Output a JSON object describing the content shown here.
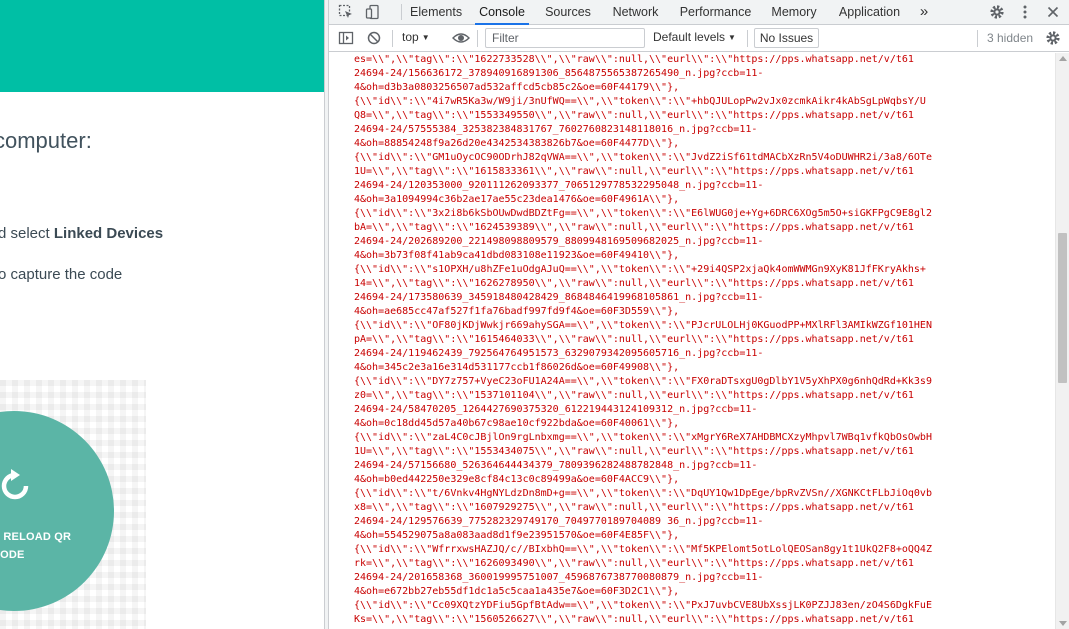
{
  "page": {
    "instruction_title": "computer:",
    "step1_prefix": "d select ",
    "step1_bold": "Linked Devices",
    "step2": "o capture the code",
    "reload_line1": "D RELOAD QR",
    "reload_line2": "CODE",
    "accent": "#00bfa5"
  },
  "devtools": {
    "tabs": [
      {
        "label": "Elements",
        "active": false
      },
      {
        "label": "Console",
        "active": true
      },
      {
        "label": "Sources",
        "active": false
      },
      {
        "label": "Network",
        "active": false
      },
      {
        "label": "Performance",
        "active": false
      },
      {
        "label": "Memory",
        "active": false
      },
      {
        "label": "Application",
        "active": false
      }
    ],
    "more_tabs": "»",
    "context": "top",
    "filter_placeholder": "Filter",
    "levels": "Default levels",
    "issues": "No Issues",
    "hidden": "3 hidden",
    "log_color": "#c80000",
    "log_lines": [
      "es=\\\\\",\\\\\"tag\\\\\":\\\\\"1622733528\\\\\",\\\\\"raw\\\\\":null,\\\\\"eurl\\\\\":\\\\\"https://pps.whatsapp.net/v/t61",
      "24694-24/156636172_378940916891306_8564875565387265490_n.jpg?ccb=11-",
      "4&oh=d3b3a0803256507ad532affcd5cb85c2&oe=60F44179\\\\\"},",
      "{\\\\\"id\\\\\":\\\\\"4i7wR5Ka3w/W9ji/3nUfWQ==\\\\\",\\\\\"token\\\\\":\\\\\"+hbQJULopPw2vJx0zcmkAikr4kAbSgLpWqbsY/U",
      "Q8=\\\\\",\\\\\"tag\\\\\":\\\\\"1553349550\\\\\",\\\\\"raw\\\\\":null,\\\\\"eurl\\\\\":\\\\\"https://pps.whatsapp.net/v/t61",
      "24694-24/57555384_325382384831767_7602760823148118016_n.jpg?ccb=11-",
      "4&oh=88854248f9a26d20e4342534383826b7&oe=60F4477D\\\\\"},",
      "{\\\\\"id\\\\\":\\\\\"GM1uOycOC90ODrhJ82qVWA==\\\\\",\\\\\"token\\\\\":\\\\\"JvdZ2iSf61tdMACbXzRn5V4oDUWHR2i/3a8/6OTe",
      "1U=\\\\\",\\\\\"tag\\\\\":\\\\\"1615833361\\\\\",\\\\\"raw\\\\\":null,\\\\\"eurl\\\\\":\\\\\"https://pps.whatsapp.net/v/t61",
      "24694-24/120353000_920111262093377_7065129778532295048_n.jpg?ccb=11-",
      "4&oh=3a1094994c36b2ae17ae55c23dea1476&oe=60F4961A\\\\\"},",
      "{\\\\\"id\\\\\":\\\\\"3x2i8b6kSbOUwDwdBDZtFg==\\\\\",\\\\\"token\\\\\":\\\\\"E6lWUG0je+Yg+6DRC6XOg5m5O+siGKFPgC9E8gl2",
      "bA=\\\\\",\\\\\"tag\\\\\":\\\\\"1624539389\\\\\",\\\\\"raw\\\\\":null,\\\\\"eurl\\\\\":\\\\\"https://pps.whatsapp.net/v/t61",
      "24694-24/202689200_221498098809579_8809948169509682025_n.jpg?ccb=11-",
      "4&oh=3b73f08f41ab9ca41dbd083108e11923&oe=60F49410\\\\\"},",
      "{\\\\\"id\\\\\":\\\\\"s1OPXH/u8hZFe1uOdgAJuQ==\\\\\",\\\\\"token\\\\\":\\\\\"+29i4QSP2xjaQk4omWWMGn9XyK81JfFKryAkhs+",
      "14=\\\\\",\\\\\"tag\\\\\":\\\\\"1626278950\\\\\",\\\\\"raw\\\\\":null,\\\\\"eurl\\\\\":\\\\\"https://pps.whatsapp.net/v/t61",
      "24694-24/173580639_345918480428429_8684846419968105861_n.jpg?ccb=11-",
      "4&oh=ae685cc47af527f1fa76badf997fd9f4&oe=60F3D559\\\\\"},",
      "{\\\\\"id\\\\\":\\\\\"OF80jKDjWwkjr669ahySGA==\\\\\",\\\\\"token\\\\\":\\\\\"PJcrULOLHj0KGuodPP+MXlRFl3AMIkWZGf101HEN",
      "pA=\\\\\",\\\\\"tag\\\\\":\\\\\"1615464033\\\\\",\\\\\"raw\\\\\":null,\\\\\"eurl\\\\\":\\\\\"https://pps.whatsapp.net/v/t61",
      "24694-24/119462439_792564764951573_6329079342095605716_n.jpg?ccb=11-",
      "4&oh=345c2e3a16e314d531177ccb1f86026d&oe=60F49908\\\\\"},",
      "{\\\\\"id\\\\\":\\\\\"DY7z757+VyeC23oFU1A24A==\\\\\",\\\\\"token\\\\\":\\\\\"FX0raDTsxgU0gDlbY1V5yXhPX0g6nhQdRd+Kk3s9",
      "z0=\\\\\",\\\\\"tag\\\\\":\\\\\"1537101104\\\\\",\\\\\"raw\\\\\":null,\\\\\"eurl\\\\\":\\\\\"https://pps.whatsapp.net/v/t61",
      "24694-24/58470205_1264427690375320_612219443124109312_n.jpg?ccb=11-",
      "4&oh=0c18dd45d57a40b67c98ae10cf922bda&oe=60F40061\\\\\"},",
      "{\\\\\"id\\\\\":\\\\\"zaL4C0cJBjlOn9rgLnbxmg==\\\\\",\\\\\"token\\\\\":\\\\\"xMgrY6ReX7AHDBMCXzyMhpvl7WBq1vfkQbOsOwbH",
      "1U=\\\\\",\\\\\"tag\\\\\":\\\\\"1553434075\\\\\",\\\\\"raw\\\\\":null,\\\\\"eurl\\\\\":\\\\\"https://pps.whatsapp.net/v/t61",
      "24694-24/57156680_526364644434379_7809396282488782848_n.jpg?ccb=11-",
      "4&oh=b0ed442250e329e8cf84c13c0c89499a&oe=60F4ACC9\\\\\"},",
      "{\\\\\"id\\\\\":\\\\\"t/6Vnkv4HgNYLdzDn8mD+g==\\\\\",\\\\\"token\\\\\":\\\\\"DqUY1Qw1DpEge/bpRvZVSn//XGNKCtFLbJiOq0vb",
      "x8=\\\\\",\\\\\"tag\\\\\":\\\\\"1607929275\\\\\",\\\\\"raw\\\\\":null,\\\\\"eurl\\\\\":\\\\\"https://pps.whatsapp.net/v/t61",
      "24694-24/129576639_775282329749170_7049770189704089 36_n.jpg?ccb=11-",
      "4&oh=554529075a8a083aad8d1f9e23951570&oe=60F4E85F\\\\\"},",
      "{\\\\\"id\\\\\":\\\\\"WfrrxwsHAZJQ/c//BIxbhQ==\\\\\",\\\\\"token\\\\\":\\\\\"Mf5KPElomt5otLolQEOSan8gy1t1UkQ2F8+oQQ4Z",
      "rk=\\\\\",\\\\\"tag\\\\\":\\\\\"1626093490\\\\\",\\\\\"raw\\\\\":null,\\\\\"eurl\\\\\":\\\\\"https://pps.whatsapp.net/v/t61",
      "24694-24/201658368_360019995751007_4596876738770080879_n.jpg?ccb=11-",
      "4&oh=e672bb27eb55df1dc1a5c5caa1a435e7&oe=60F3D2C1\\\\\"},",
      "{\\\\\"id\\\\\":\\\\\"Cc09XQtzYDFiu5GpfBtAdw==\\\\\",\\\\\"token\\\\\":\\\\\"PxJ7uvbCVE8UbXssjLK0PZJJ83en/zO4S6DgkFuE",
      "Ks=\\\\\",\\\\\"tag\\\\\":\\\\\"1560526627\\\\\",\\\\\"raw\\\\\":null,\\\\\"eurl\\\\\":\\\\\"https://pps.whatsapp.net/v/t61"
    ]
  }
}
